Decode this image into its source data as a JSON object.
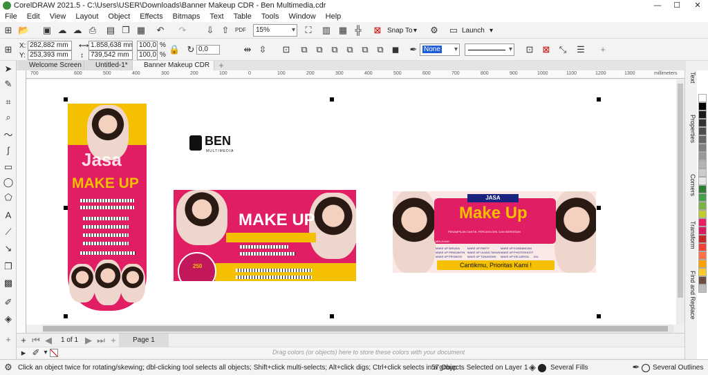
{
  "window": {
    "title": "CorelDRAW 2021.5 - C:\\Users\\USER\\Downloads\\Banner Makeup CDR - Ben Multimedia.cdr",
    "controls": [
      "—",
      "☐",
      "✕"
    ]
  },
  "menu": [
    "File",
    "Edit",
    "View",
    "Layout",
    "Object",
    "Effects",
    "Bitmaps",
    "Text",
    "Table",
    "Tools",
    "Window",
    "Help"
  ],
  "standard_toolbar": {
    "zoom": "15%",
    "snap_to": "Snap To",
    "launch": "Launch"
  },
  "property_bar": {
    "x_label": "X:",
    "x": "282,882 mm",
    "y_label": "Y:",
    "y": "253,393 mm",
    "width": "1.858,638 mm",
    "height": "739,542 mm",
    "scale_x": "100,0",
    "scale_y": "100,0",
    "pct": "%",
    "angle": "0,0",
    "outline": "None"
  },
  "tabs": {
    "welcome": "Welcome Screen",
    "untitled": "Untitled-1*",
    "active": "Banner Makeup CDR ..."
  },
  "ruler": {
    "h_ticks": [
      "700",
      "600",
      "500",
      "400",
      "300",
      "200",
      "100",
      "0",
      "100",
      "200",
      "300",
      "400",
      "500",
      "600",
      "700",
      "800",
      "900",
      "1000",
      "1100",
      "1200",
      "1300"
    ],
    "unit": "millimeters"
  },
  "artwork": {
    "left_banner": {
      "title": "Jasa",
      "subtitle": "MAKE UP"
    },
    "logo": {
      "name": "BEN",
      "sub": "MULTIMEDIA"
    },
    "middle_banner": {
      "title": "MAKE UP",
      "price": "250"
    },
    "right_banner": {
      "jasa": "JASA",
      "title": "Make Up",
      "tagline": "PENAMPILAN CANTIK, PERCAYA DIRI, DAN BERKESAN",
      "services_label": "MELAYANI :",
      "services": [
        "MAKE UP WISUDA",
        "MAKE UP PARTY",
        "MAKE UP KONDANGAN",
        "MAKE UP PENGANTIN",
        "MAKE UP ULANG TAHUN",
        "MAKE UP PHOTOSHOOT",
        "MAKE UP PROMOSI",
        "MAKE UP TUNANGAN",
        "MAKE UP KELUARGA",
        "DLL"
      ],
      "slogan": "Cantikmu, Prioritas Kami !"
    }
  },
  "dockers": [
    "Text",
    "Properties",
    "Corners",
    "Transform",
    "Find and Replace"
  ],
  "palette": [
    "#ffffff",
    "#000000",
    "#1a1a1a",
    "#333333",
    "#4d4d4d",
    "#666666",
    "#808080",
    "#999999",
    "#b3b3b3",
    "#cccccc",
    "#e6e6e6",
    "#2e7d32",
    "#43a047",
    "#7cb342",
    "#c0ca33",
    "#e91e63",
    "#d81b60",
    "#c62828",
    "#f44336",
    "#ff7043",
    "#ffa000",
    "#ffca28",
    "#6d4c41",
    "#bdbdbd"
  ],
  "page_nav": {
    "of": "1 of 1",
    "page": "Page 1"
  },
  "colorbar_hint": "Drag colors (or objects) here to store these colors with your document",
  "status": {
    "hint": "Click an object twice for rotating/skewing; dbl-clicking tool selects all objects; Shift+click multi-selects; Alt+click digs; Ctrl+click selects in a group",
    "selection": "57 Objects Selected on Layer 1",
    "fill": "Several Fills",
    "outline": "Several Outlines"
  }
}
